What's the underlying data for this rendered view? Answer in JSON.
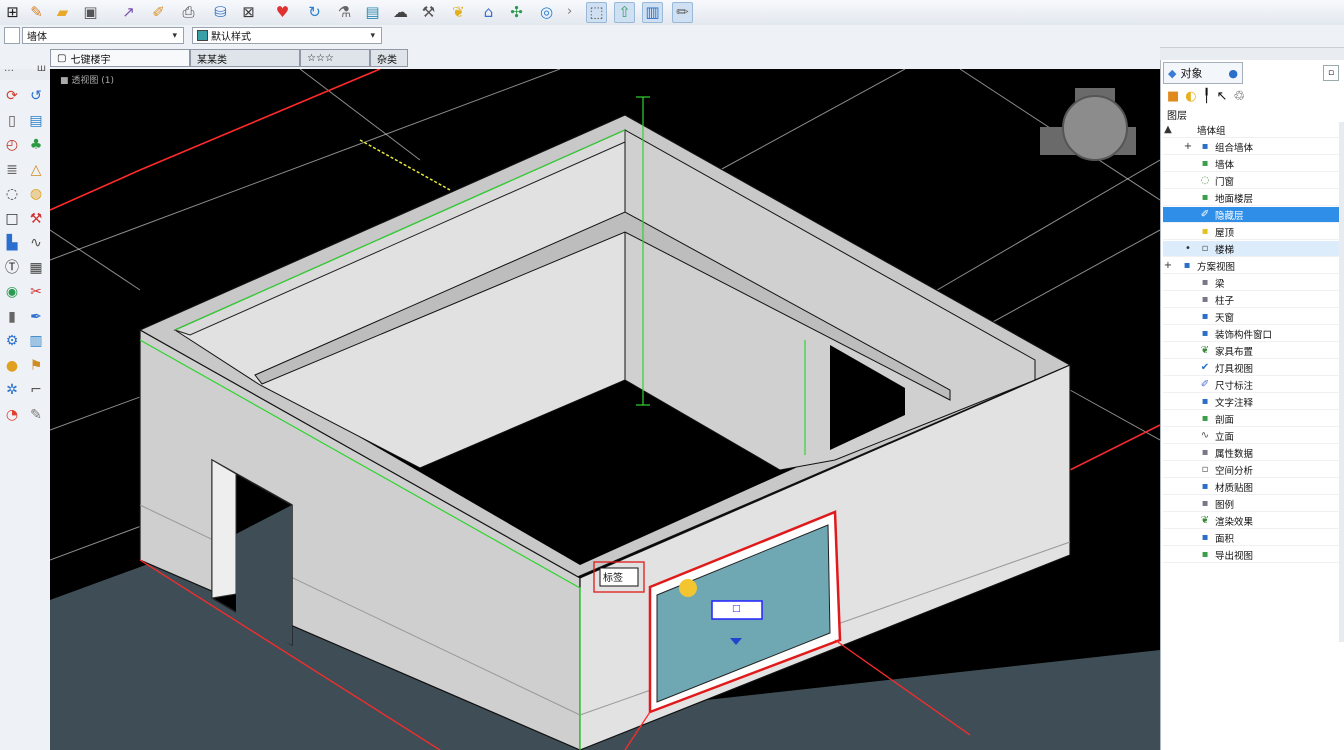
{
  "toolbar": {
    "icons": [
      "layout-icon",
      "pencil-icon",
      "open-folder-icon",
      "save-icon",
      "measure-icon",
      "brush-icon",
      "print-icon",
      "database-icon",
      "zoom-window-icon",
      "heart-icon",
      "cycle-icon",
      "flask-icon",
      "screen-icon",
      "cloud-icon",
      "tools-icon",
      "leaf-icon",
      "home-icon",
      "fan-icon",
      "target-icon",
      "select-icon",
      "arrow-up-icon",
      "panel-icon",
      "edit-icon"
    ]
  },
  "properties": {
    "layer_value": "墙体",
    "style_value": "默认样式"
  },
  "tabs": [
    {
      "label": "七键楼宇",
      "active": true
    },
    {
      "label": "某某类",
      "active": false
    },
    {
      "label": "☆☆☆",
      "active": false
    },
    {
      "label": "杂类",
      "active": false
    }
  ],
  "left_header": {
    "label": "…",
    "extra": "ш"
  },
  "palette": {
    "icons": [
      "rotate-icon",
      "refresh-icon",
      "door-icon",
      "window-icon",
      "clock-icon",
      "plant-icon",
      "stair-icon",
      "triangle-icon",
      "circle-icon",
      "bulb-icon",
      "square-icon",
      "hammer-icon",
      "sofa-icon",
      "curve-icon",
      "text-icon",
      "grid-icon",
      "globe-icon",
      "scissors-icon",
      "book-icon",
      "pen-icon",
      "tools-icon",
      "panel-icon",
      "sphere-icon",
      "flag-icon",
      "gear-icon",
      "measure-icon",
      "chart-icon",
      "brush-icon"
    ]
  },
  "viewport": {
    "label": "■ 透视图 (1)",
    "tag_label": "标签",
    "window_tag": "□",
    "colors": {
      "background": "#000000",
      "wall": "#d8d8d8",
      "floor": "#3f4e56",
      "glass": "#6fa7b3",
      "red_axis": "#ff2a2a",
      "green_axis": "#2fd42f"
    }
  },
  "right_panel": {
    "tab_label": "对象",
    "group_label": "图层",
    "rows": [
      {
        "label": "墙体组",
        "depth": 0,
        "expander": "▲",
        "icon": "none"
      },
      {
        "label": "组合墙体",
        "depth": 1,
        "expander": "+",
        "icon": "blue"
      },
      {
        "label": "墙体",
        "depth": 2,
        "expander": "",
        "icon": "green"
      },
      {
        "label": "门窗",
        "depth": 2,
        "expander": "",
        "icon": "circle"
      },
      {
        "label": "地面楼层",
        "depth": 2,
        "expander": "",
        "icon": "green"
      },
      {
        "label": "隐藏层",
        "depth": 2,
        "expander": "",
        "icon": "pen",
        "state": "selected"
      },
      {
        "label": "屋顶",
        "depth": 2,
        "expander": "",
        "icon": "yellow"
      },
      {
        "label": "楼梯",
        "depth": 1,
        "expander": "•",
        "icon": "doc",
        "state": "highlight"
      },
      {
        "label": "方案视图",
        "depth": 0,
        "expander": "+",
        "icon": "blue"
      },
      {
        "label": "梁",
        "depth": 2,
        "expander": "",
        "icon": "gray"
      },
      {
        "label": "柱子",
        "depth": 2,
        "expander": "",
        "icon": "gray"
      },
      {
        "label": "天窗",
        "depth": 2,
        "expander": "",
        "icon": "blue"
      },
      {
        "label": "装饰构件窗口",
        "depth": 2,
        "expander": "",
        "icon": "blue"
      },
      {
        "label": "家具布置",
        "depth": 2,
        "expander": "",
        "icon": "leaf"
      },
      {
        "label": "灯具视图",
        "depth": 2,
        "expander": "",
        "icon": "check"
      },
      {
        "label": "尺寸标注",
        "depth": 2,
        "expander": "",
        "icon": "pen"
      },
      {
        "label": "文字注释",
        "depth": 2,
        "expander": "",
        "icon": "blue"
      },
      {
        "label": "剖面",
        "depth": 2,
        "expander": "",
        "icon": "green"
      },
      {
        "label": "立面",
        "depth": 2,
        "expander": "",
        "icon": "curve"
      },
      {
        "label": "属性数据",
        "depth": 2,
        "expander": "",
        "icon": "gray"
      },
      {
        "label": "空间分析",
        "depth": 2,
        "expander": "",
        "icon": "doc"
      },
      {
        "label": "材质贴图",
        "depth": 2,
        "expander": "",
        "icon": "blue"
      },
      {
        "label": "图例",
        "depth": 2,
        "expander": "",
        "icon": "gray"
      },
      {
        "label": "渲染效果",
        "depth": 2,
        "expander": "",
        "icon": "leaf"
      },
      {
        "label": "面积",
        "depth": 2,
        "expander": "",
        "icon": "blue"
      },
      {
        "label": "导出视图",
        "depth": 2,
        "expander": "",
        "icon": "green"
      }
    ]
  }
}
